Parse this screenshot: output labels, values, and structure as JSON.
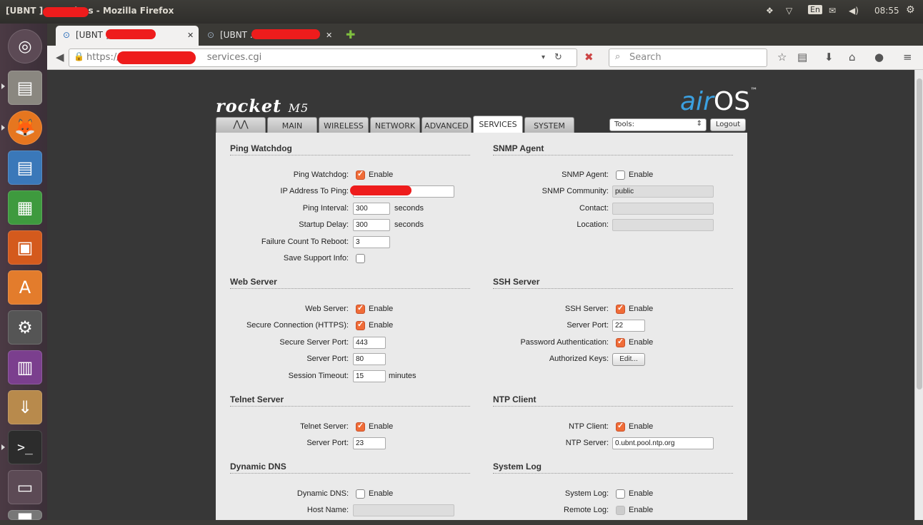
{
  "window": {
    "title": "[UBNT ] - Services - Mozilla Firefox",
    "time": "08:55",
    "lang": "En"
  },
  "browser": {
    "tabs": [
      {
        "label": "[UBNT ] - S...",
        "active": true
      },
      {
        "label": "[UBNT .",
        "active": false
      }
    ],
    "url_prefix": "https://",
    "url_suffix": "services.cgi",
    "search_placeholder": "Search"
  },
  "header": {
    "product": "rocket",
    "model": "M5",
    "os_brand_a": "air",
    "os_brand_b": "OS",
    "tm": "™"
  },
  "nav": {
    "tabs": [
      "MAIN",
      "WIRELESS",
      "NETWORK",
      "ADVANCED",
      "SERVICES",
      "SYSTEM"
    ],
    "selected": "SERVICES",
    "tools_label": "Tools:",
    "logout_label": "Logout"
  },
  "sections": {
    "ping_watchdog": {
      "title": "Ping Watchdog",
      "enable_label": "Ping Watchdog:",
      "enable_text": "Enable",
      "enabled": true,
      "ip_label": "IP Address To Ping:",
      "ip_value": "",
      "interval_label": "Ping Interval:",
      "interval_value": "300",
      "interval_unit": "seconds",
      "delay_label": "Startup Delay:",
      "delay_value": "300",
      "delay_unit": "seconds",
      "failure_label": "Failure Count To Reboot:",
      "failure_value": "3",
      "support_label": "Save Support Info:",
      "support_checked": false
    },
    "snmp": {
      "title": "SNMP Agent",
      "enable_label": "SNMP Agent:",
      "enable_text": "Enable",
      "enabled": false,
      "community_label": "SNMP Community:",
      "community_value": "public",
      "contact_label": "Contact:",
      "contact_value": "",
      "location_label": "Location:",
      "location_value": ""
    },
    "web": {
      "title": "Web Server",
      "enable_label": "Web Server:",
      "enable_text": "Enable",
      "enabled": true,
      "https_label": "Secure Connection (HTTPS):",
      "https_text": "Enable",
      "https_enabled": true,
      "secure_port_label": "Secure Server Port:",
      "secure_port_value": "443",
      "port_label": "Server Port:",
      "port_value": "80",
      "timeout_label": "Session Timeout:",
      "timeout_value": "15",
      "timeout_unit": "minutes"
    },
    "ssh": {
      "title": "SSH Server",
      "enable_label": "SSH Server:",
      "enable_text": "Enable",
      "enabled": true,
      "port_label": "Server Port:",
      "port_value": "22",
      "pw_label": "Password Authentication:",
      "pw_text": "Enable",
      "pw_enabled": true,
      "keys_label": "Authorized Keys:",
      "keys_button": "Edit..."
    },
    "telnet": {
      "title": "Telnet Server",
      "enable_label": "Telnet Server:",
      "enable_text": "Enable",
      "enabled": true,
      "port_label": "Server Port:",
      "port_value": "23"
    },
    "ntp": {
      "title": "NTP Client",
      "enable_label": "NTP Client:",
      "enable_text": "Enable",
      "enabled": true,
      "server_label": "NTP Server:",
      "server_value": "0.ubnt.pool.ntp.org"
    },
    "ddns": {
      "title": "Dynamic DNS",
      "enable_label": "Dynamic DNS:",
      "enable_text": "Enable",
      "enabled": false,
      "host_label": "Host Name:",
      "host_value": ""
    },
    "syslog": {
      "title": "System Log",
      "enable_label": "System Log:",
      "enable_text": "Enable",
      "enabled": false,
      "remote_label": "Remote Log:",
      "remote_text": "Enable",
      "remote_enabled": false
    }
  },
  "colors": {
    "accent_check": "#f06c37",
    "redaction": "#ee1c1c",
    "panel_bg": "#eaeaea",
    "airos_blue": "#3ba0e0"
  }
}
